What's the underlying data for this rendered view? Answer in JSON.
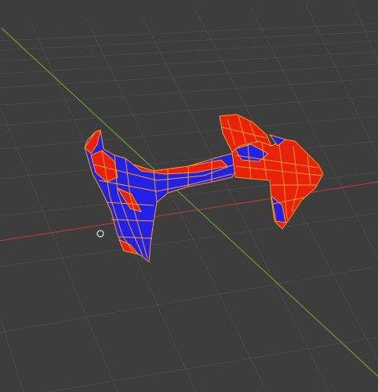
{
  "viewport": {
    "background_color": "#3d3d3d",
    "grid_color": "#4a4a4a",
    "x_axis_color": "#b33a3a",
    "y_axis_color": "#6e9a2e"
  },
  "mesh": {
    "face_color_a": "#e8210d",
    "face_color_b": "#2222e6",
    "wire_color": "#ff9a1a"
  },
  "cursor_3d": {
    "icon": "3d-cursor-icon",
    "color": "#e6e6e6"
  }
}
